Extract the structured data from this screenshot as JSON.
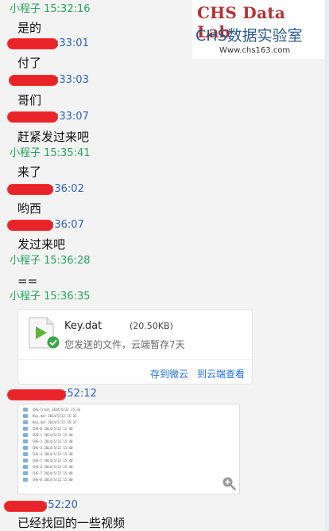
{
  "watermark": {
    "line1": "CHS Data Lab",
    "line2": "CHS数据实验室",
    "url": "Www.chs163.com"
  },
  "messages": [
    {
      "sender": "小程子 15:32:16",
      "text": "是的"
    },
    {
      "sender": ":33:01",
      "text": "付了"
    },
    {
      "sender": ":33:03",
      "text": "哥们"
    },
    {
      "sender": ":33:07",
      "text": "赶紧发过来吧"
    },
    {
      "sender": "小程子 15:35:41",
      "text": "来了"
    },
    {
      "sender": ":36:02",
      "text": "哟西"
    },
    {
      "sender": ":36:07",
      "text": "发过来吧"
    },
    {
      "sender": "小程子 15:36:28",
      "text": "=="
    },
    {
      "sender": "小程子 15:36:35",
      "text": ""
    },
    {
      "sender": ":52:12",
      "text": ""
    },
    {
      "sender": ":52:20",
      "text": "已经找回的一些视频"
    }
  ],
  "file_card": {
    "name": "Key.dat",
    "size": "(20.50KB)",
    "status": "您发送的文件，云端暂存7天",
    "action_save": "存到微云",
    "action_view": "到云端查看"
  },
  "screenshot_rows": [
    "CHS-Trash 2014/5/22 15:33",
    "Key.dat 2014/5/22 15:33",
    "Key.dat 2014/5/22 15:37",
    "CHS-0 2014/5/22 15:40",
    "CHS-1 2014/5/22 15:40",
    "CHS-2 2014/5/22 15:40",
    "CHS-3 2014/5/22 15:40",
    "CHS-4 2014/5/22 15:40",
    "CHS-5 2014/5/22 15:40",
    "CHS-6 2014/5/22 15:40",
    "CHS-7 2014/5/22 15:40",
    "CHS-8 2014/5/22 15:40"
  ],
  "colors": {
    "self_sender": "#23a55a",
    "other_sender": "#2b62b6",
    "redaction": "#e8232a",
    "link": "#1e6fd9"
  }
}
